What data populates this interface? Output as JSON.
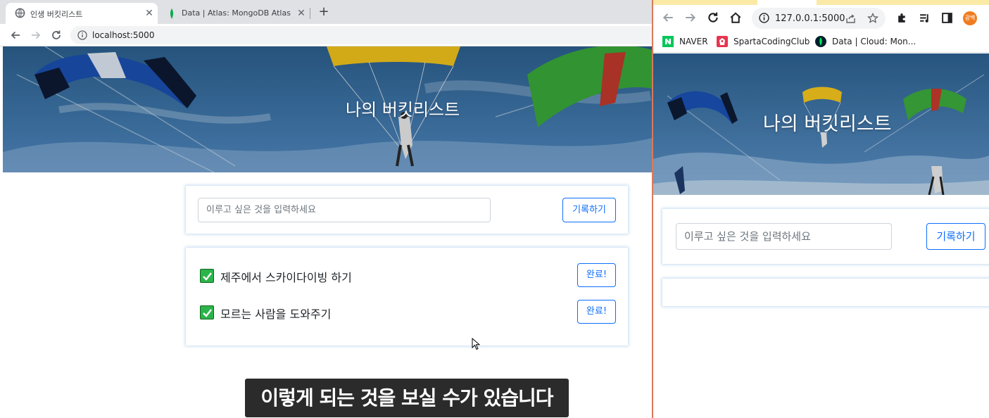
{
  "left_window": {
    "tabs": [
      {
        "title": "인생 버킷리스트",
        "favicon": "globe-icon"
      },
      {
        "title": "Data | Atlas: MongoDB Atlas",
        "favicon": "mongodb-leaf-icon"
      }
    ],
    "url": "localhost:5000"
  },
  "right_window": {
    "url": "127.0.0.1:5000",
    "profile_initials": "광백",
    "bookmarks": [
      {
        "label": "NAVER",
        "icon": "naver-icon"
      },
      {
        "label": "SpartaCodingClub",
        "icon": "sparta-icon"
      },
      {
        "label": "Data | Cloud: Mon...",
        "icon": "mongodb-leaf-icon"
      }
    ]
  },
  "page": {
    "title": "나의 버킷리스트",
    "input_placeholder": "이루고 싶은 것을 입력하세요",
    "save_button": "기록하기",
    "items": [
      {
        "text": "제주에서 스카이다이빙 하기",
        "done_label": "완료!",
        "checked": true
      },
      {
        "text": "모르는 사람을 도와주기",
        "done_label": "완료!",
        "checked": true
      }
    ]
  },
  "caption": "이렇게 되는 것을 보실 수가 있습니다",
  "colors": {
    "accent": "#0d6efd",
    "check_green": "#2bb44a",
    "caption_bg": "#2b2b2b",
    "sky_top": "#2b5f8e",
    "sky_bottom": "#4f88bf"
  }
}
